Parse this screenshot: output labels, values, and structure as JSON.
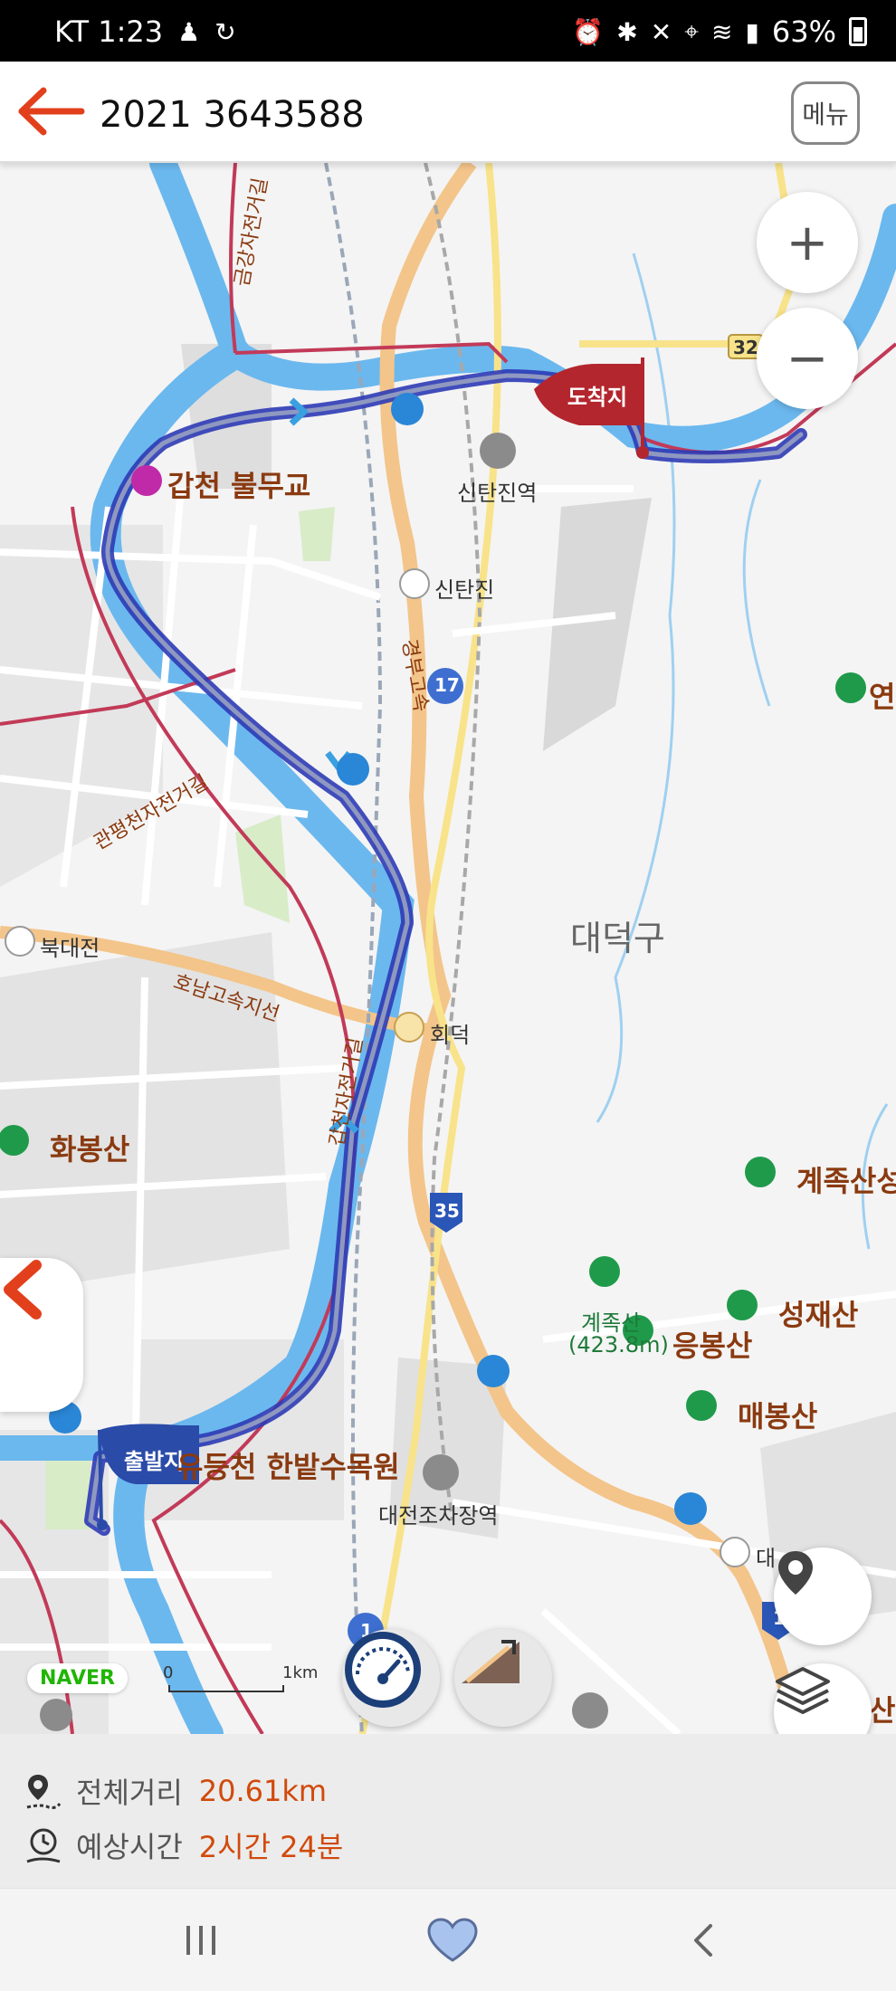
{
  "status_bar": {
    "carrier_time": "KT 1:23",
    "battery": "63%"
  },
  "header": {
    "title": "2021 3643588",
    "menu_label": "메뉴"
  },
  "map": {
    "labels": {
      "gapcheon": "갑천 불무교",
      "sintanjin_station": "신탄진역",
      "sintanjin_ic": "신탄진",
      "daedeok_gu": "대덕구",
      "hoedeok": "회덕",
      "bukdaejeon": "북대전",
      "hwabongsan": "화봉산",
      "gyejoksan": "계족산성",
      "gyejoksan_peak": "계족산",
      "gyejoksan_height": "(423.8m)",
      "eungbongsan": "응봉산",
      "seongjaesan": "성재산",
      "maebongsan": "매봉산",
      "yudeungcheon": "유등천 한밭수목원",
      "daejeon_yard": "대전조차장역",
      "honam_expressway": "호남고속지선",
      "gyeongbu_expressway": "경부고속",
      "gapcheon_bike": "갑천자전거길",
      "gwanpyeong_bike": "관평천자전거길",
      "geumgang_bike": "금강자전거길",
      "yeon_mountain": "연",
      "daejeon_ic": "대",
      "mountain_se": "산",
      "route_17": "17",
      "route_35": "35",
      "route_32": "32",
      "route_1": "1",
      "route_11": "1"
    },
    "start_flag": "출발지",
    "end_flag": "도착지",
    "zoom_in": "+",
    "zoom_out": "−",
    "naver_logo": "NAVER",
    "scale_zero": "0",
    "scale_km": "1km"
  },
  "info": {
    "distance_label": "전체거리",
    "distance_value": "20.61km",
    "time_label": "예상시간",
    "time_value": "2시간 24분"
  },
  "colors": {
    "accent": "#d14a0c",
    "route": "#2d3bb5",
    "river": "#4aa8e8",
    "end_flag": "#b3262e",
    "start_flag": "#2a4ba8"
  },
  "icons": [
    "back-arrow-icon",
    "location-pin-icon",
    "layers-icon",
    "speedometer-icon",
    "elevation-icon",
    "heart-icon"
  ]
}
